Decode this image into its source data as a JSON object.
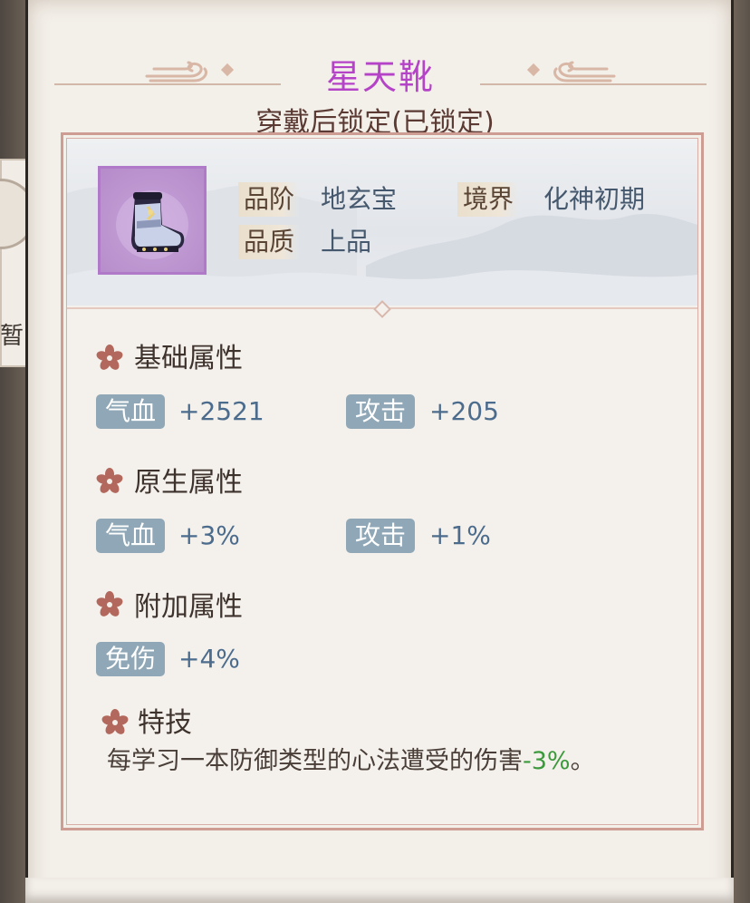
{
  "background": {
    "side_tab_label": "暂"
  },
  "item": {
    "name": "星天靴",
    "name_color": "#b543c7",
    "lock_status": "穿戴后锁定(已锁定)",
    "icon": "boot-icon",
    "frame_color": "#b17ac8"
  },
  "meta": {
    "grade_label": "品阶",
    "grade_value": "地玄宝",
    "realm_label": "境界",
    "realm_value": "化神初期",
    "quality_label": "品质",
    "quality_value": "上品"
  },
  "sections": {
    "base": {
      "title": "基础属性",
      "stats": [
        {
          "label": "气血",
          "value": "+2521"
        },
        {
          "label": "攻击",
          "value": "+205"
        }
      ]
    },
    "native": {
      "title": "原生属性",
      "stats": [
        {
          "label": "气血",
          "value": "+3%"
        },
        {
          "label": "攻击",
          "value": "+1%"
        }
      ]
    },
    "extra": {
      "title": "附加属性",
      "stats": [
        {
          "label": "免伤",
          "value": "+4%"
        }
      ]
    },
    "skill": {
      "title": "特技",
      "text_prefix": "每学习一本防御类型的心法遭受的伤害",
      "text_highlight": "-3%",
      "text_suffix": "。"
    }
  },
  "colors": {
    "stat_tag_bg": "#8fa7b6",
    "stat_value": "#4c6c8d",
    "highlight": "#3c9a3c",
    "card_border": "#cd9c92"
  }
}
